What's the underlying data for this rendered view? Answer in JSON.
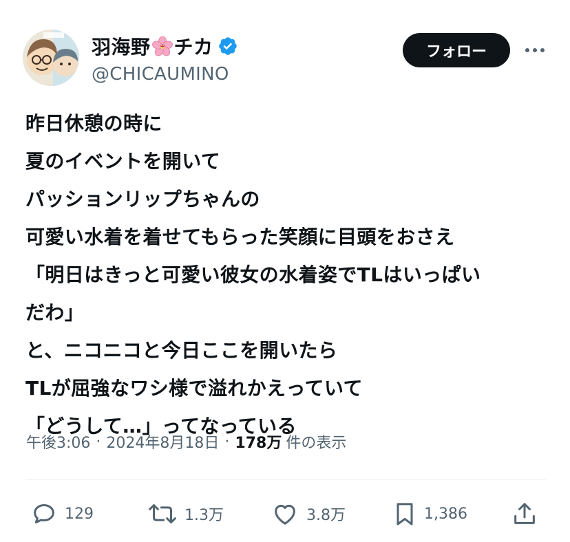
{
  "author": {
    "display_name_part1": "羽海野",
    "display_name_part2": "チカ",
    "handle": "@CHICAUMINO",
    "verified": true
  },
  "follow_button_label": "フォロー",
  "tweet_lines": [
    "昨日休憩の時に",
    "夏のイベントを開いて",
    "パッションリップちゃんの",
    "可愛い水着を着せてもらった笑顔に目頭をおさえ",
    "「明日はきっと可愛い彼女の水着姿でTLはいっぱい",
    "だわ」",
    "と、ニコニコと今日ここを開いたら",
    "TLが屈強なワシ様で溢れかえっていて",
    "「どうして…」ってなっている"
  ],
  "meta": {
    "time": "午後3:06",
    "separator": "·",
    "date": "2024年8月18日",
    "views_count": "178万",
    "views_label": "件の表示"
  },
  "actions": {
    "reply_count": "129",
    "repost_count": "1.3万",
    "like_count": "3.8万",
    "bookmark_count": "1,386"
  },
  "icons": {
    "verified": "verified-badge-icon",
    "flower": "cherry-blossom-icon",
    "more": "more-dots-icon",
    "reply": "reply-icon",
    "repost": "repost-icon",
    "like": "heart-icon",
    "bookmark": "bookmark-icon",
    "share": "share-icon"
  },
  "colors": {
    "text": "#0f1419",
    "secondary": "#536471",
    "verified_blue": "#1d9bf0",
    "follow_bg": "#0f1419",
    "divider": "#eff3f4"
  }
}
